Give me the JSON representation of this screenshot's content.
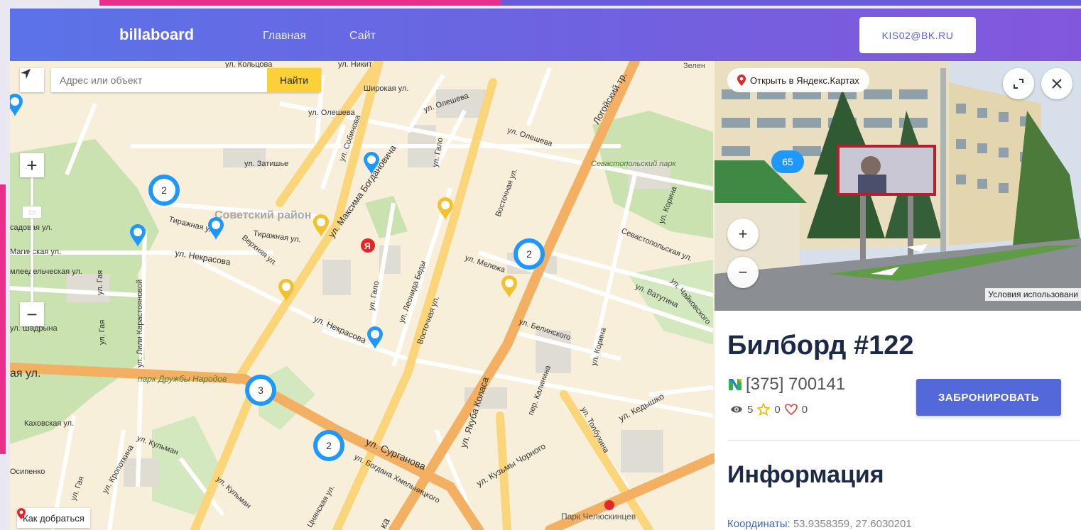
{
  "header": {
    "logo": "billaboard",
    "nav": [
      "Главная",
      "Сайт"
    ],
    "user_email": "KIS02@BK.RU"
  },
  "map": {
    "search_placeholder": "Адрес или объект",
    "search_button": "Найти",
    "route_label": "Как добраться",
    "clusters": [
      "2",
      "2",
      "3",
      "2"
    ],
    "labels": {
      "kolcova": "ул. Кольцова",
      "nikit": "ул. Никит",
      "zelen": "Зелен",
      "shirokaya": "Широкая ул.",
      "olesheva1": "ул. Олешева",
      "olesheva2": "ул. Олешева",
      "olesheva3": "ул. Олешева",
      "logoisky": "Логойский тр.",
      "zatishe": "ул. Затишье",
      "sobinova": "ул. Собинова",
      "maksima": "ул. Максима Богдановича",
      "sovetsky": "Советский район",
      "tirazhnaya1": "Тиражная ул.",
      "tirazhnaya2": "Тиражная ул.",
      "nekrasova1": "ул. Некрасова",
      "nekrasova2": "ул. Некрасова",
      "verhnyaya": "Верхняя ул.",
      "gaya1": "ул. Гая",
      "gaya2": "ул. Гая",
      "galo1": "ул. Гало",
      "galo2": "ул. Гало",
      "leonida": "ул. Леонида Беды",
      "vostochnaya1": "Восточная ул.",
      "vostochnaya2": "Восточная ул.",
      "melezha": "ул. Мележа",
      "sevpark": "Севастопольский парк",
      "sevastopol": "Севастопольская ул.",
      "korinka1": "ул. Корина",
      "korinka2": "ул. Корина",
      "vatutina": "ул. Ватутина",
      "chaikovsk": "ул. Чайковского",
      "karastoyanovoy": "ул. Лили Карастояновой",
      "sadovaya": "садовая ул.",
      "maginskaya": "Магинская ул.",
      "mledelch": "млеедельческая ул.",
      "shadryna": "ул. Шадрына",
      "ayaul": "ая ул.",
      "druzhby": "парк Дружбы Народов",
      "yakuba": "ул. Якуба Коласа",
      "belinskogo": "ул. Белинского",
      "kalinina": "пер. Калинина",
      "tolbuhina": "ул. Толбухина",
      "kedyshko": "ул. Кедышко",
      "surganova": "ул. Сурганова",
      "hmelnickogo": "ул. Богдана Хмельницкого",
      "kuzmy": "ул. Кузьмы Чорного",
      "kahovskaya": "Каховская ул.",
      "kulman1": "ул. Кульман",
      "kulman2": "ул. Кульман",
      "kropotkina": "ул. Кропоткина",
      "gaya3": "ул. Гая",
      "osipenko": "Осипенко",
      "chelyuskincev": "Парк Челюскинцев",
      "cninskaya": "Цнянская ул.",
      "ka": "ка"
    }
  },
  "panorama": {
    "open_label": "Открыть в Яндекс.Картах",
    "badge": "65",
    "terms": "Условия использовани"
  },
  "info": {
    "title": "Билборд #122",
    "phone": "[375] 700141",
    "views": "5",
    "stars": "0",
    "likes": "0",
    "book_button": "ЗАБРОНИРОВАТЬ",
    "section": "Информация",
    "coords_label": "Координаты:",
    "coords_value": "53.9358359, 27.6030201"
  },
  "colors": {
    "header_start": "#5b73e8",
    "header_end": "#8357dd",
    "accent": "#5368d9",
    "cluster": "#1e98ff",
    "pin_yellow": "#f2c12e",
    "pin_blue": "#1e98ff"
  }
}
